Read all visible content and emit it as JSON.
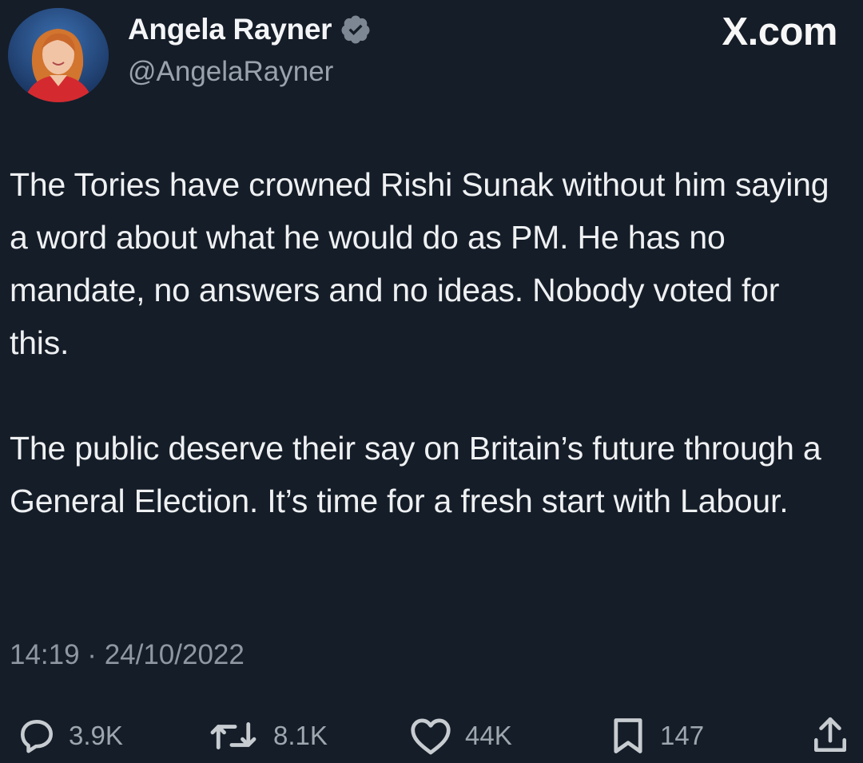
{
  "author": {
    "display_name": "Angela Rayner",
    "handle": "@AngelaRayner",
    "verified_icon": "verified-badge-icon"
  },
  "brand": "X.com",
  "tweet": {
    "paragraphs": [
      "The Tories have crowned Rishi Sunak without him saying a word about what he would do as PM. He has no mandate, no answers and no ideas. Nobody voted for this.",
      "The public deserve their say on Britain’s future through a General Election. It’s time for a fresh start with Labour."
    ],
    "timestamp": "14:19 · 24/10/2022"
  },
  "actions": {
    "replies": "3.9K",
    "reposts": "8.1K",
    "likes": "44K",
    "bookmarks": "147"
  },
  "colors": {
    "background": "#151d28",
    "text": "#eef0f2",
    "muted": "#8f98a2",
    "verified": "#7d8793"
  }
}
